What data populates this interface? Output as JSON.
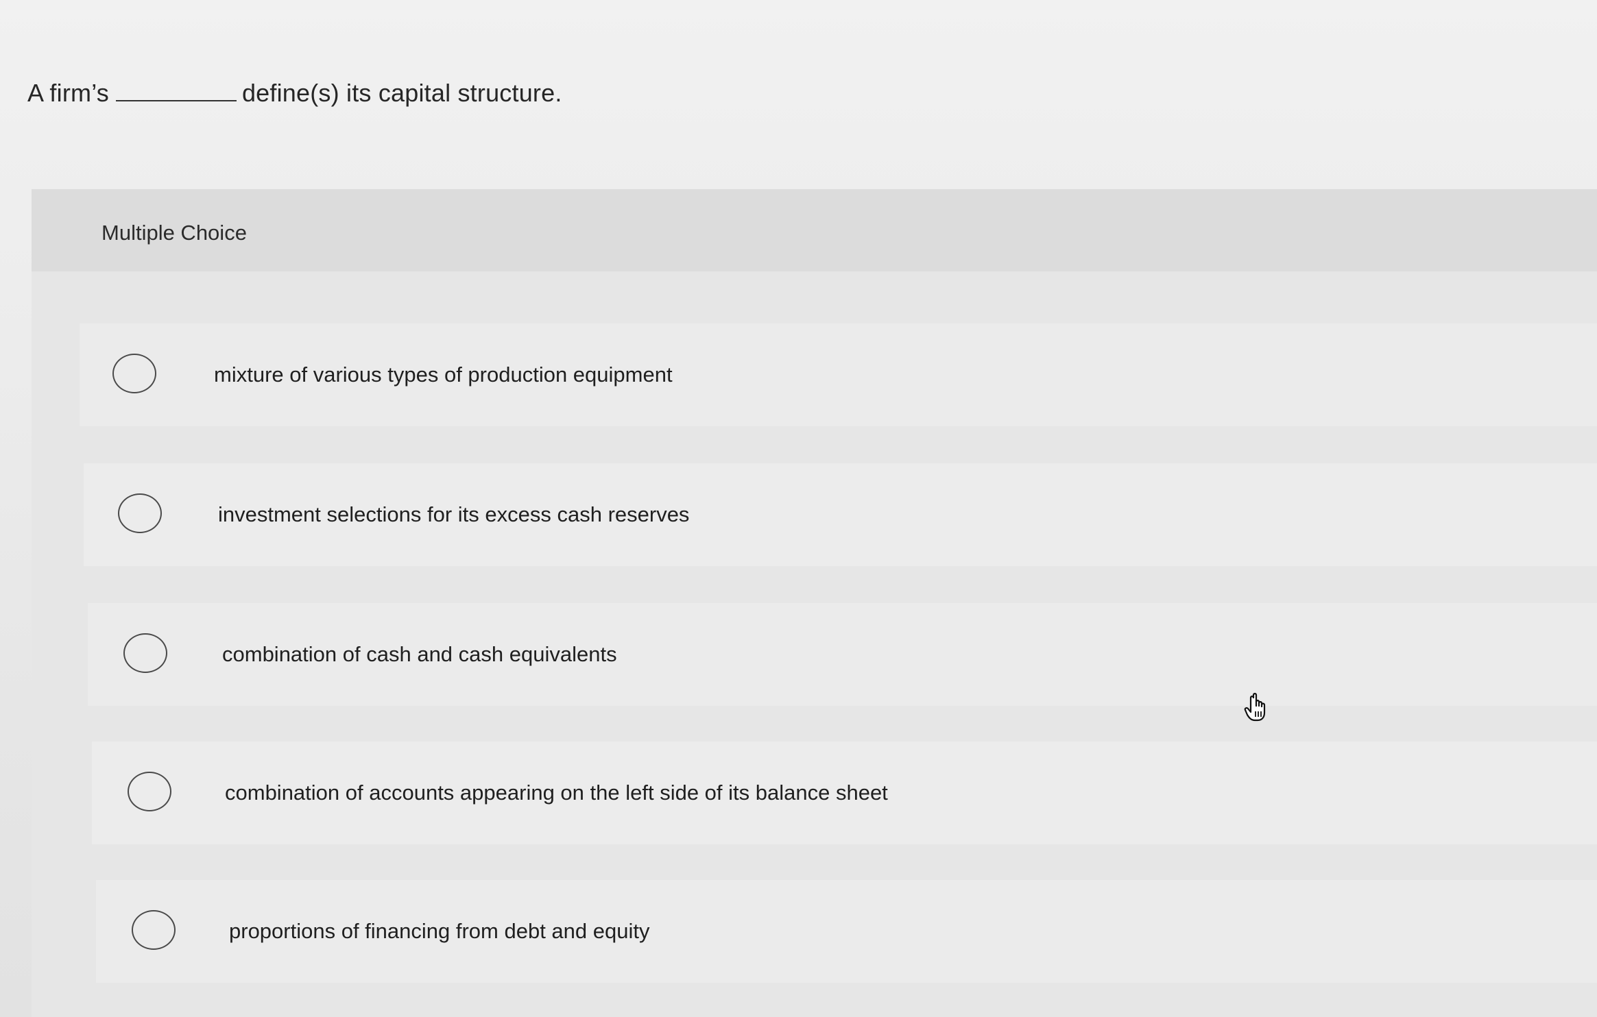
{
  "question": {
    "prefix": "A firm’s",
    "suffix": "define(s) its capital structure."
  },
  "multiple_choice": {
    "header_label": "Multiple Choice",
    "options": [
      {
        "label": "mixture of various types of production equipment",
        "selected": false
      },
      {
        "label": "investment selections for its excess cash reserves",
        "selected": false
      },
      {
        "label": "combination of cash and cash equivalents",
        "selected": false
      },
      {
        "label": "combination of accounts appearing on the left side of its balance sheet",
        "selected": false
      },
      {
        "label": "proportions of financing from debt and equity",
        "selected": false
      }
    ]
  },
  "cursor": {
    "icon": "hand-pointer-icon"
  }
}
